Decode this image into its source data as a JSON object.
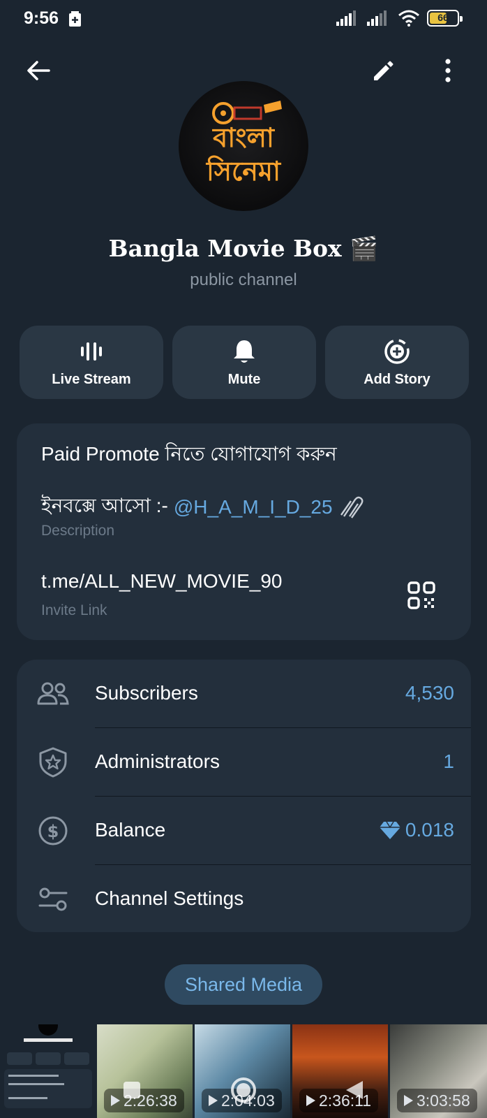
{
  "status_bar": {
    "time": "9:56",
    "battery": "66",
    "battery_level": 0.66
  },
  "header": {
    "back_icon": "arrow-left-icon",
    "edit_icon": "pencil-icon",
    "more_icon": "more-vertical-icon"
  },
  "avatar": {
    "line1": "বাংলা",
    "line2": "সিনেমা"
  },
  "channel": {
    "title": "Bangla Movie Box 🎬",
    "type": "public channel"
  },
  "actions": [
    {
      "label": "Live Stream",
      "icon": "live-stream-icon"
    },
    {
      "label": "Mute",
      "icon": "bell-icon"
    },
    {
      "label": "Add Story",
      "icon": "add-story-icon"
    }
  ],
  "info": {
    "description_line1": "Paid Promote নিতে যোগাযোগ করুন",
    "description_line2_prefix": "ইনবক্সে আসো :-",
    "description_mention": "@H_A_M_I_D_25",
    "description_caption": "Description",
    "invite_link": "t.me/ALL_NEW_MOVIE_90",
    "invite_caption": "Invite Link"
  },
  "stats": [
    {
      "label": "Subscribers",
      "value": "4,530",
      "icon": "users-icon"
    },
    {
      "label": "Administrators",
      "value": "1",
      "icon": "shield-star-icon"
    },
    {
      "label": "Balance",
      "value": "0.018",
      "icon": "dollar-circle-icon",
      "value_icon": "diamond-icon"
    },
    {
      "label": "Channel Settings",
      "value": "",
      "icon": "settings-sliders-icon"
    }
  ],
  "shared_media": {
    "label": "Shared Media"
  },
  "media": [
    {
      "duration": "",
      "kind": "screenshot"
    },
    {
      "duration": "2:26:38",
      "kind": "video"
    },
    {
      "duration": "2:04:03",
      "kind": "video"
    },
    {
      "duration": "2:36:11",
      "kind": "video"
    },
    {
      "duration": "3:03:58",
      "kind": "video"
    }
  ],
  "colors": {
    "background": "#1b2530",
    "card": "#232f3c",
    "button": "#2a3744",
    "accent": "#66a9e0",
    "muted": "#8c97a3"
  }
}
